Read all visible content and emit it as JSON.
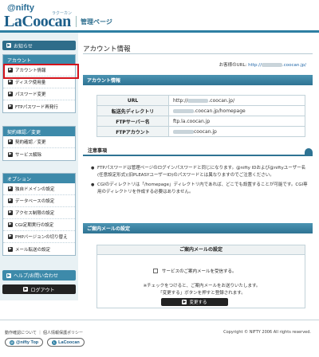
{
  "header": {
    "brand_nifty": "@nifty",
    "brand_lacoocan": "LaCoocan",
    "brand_ruby": "ラクーカン",
    "title": "管理ページ"
  },
  "sidebar": {
    "notice": "お知らせ",
    "account_section": {
      "heading": "アカウント",
      "items": [
        {
          "label": "アカウント情報"
        },
        {
          "label": "ディスク使用量"
        },
        {
          "label": "パスワード変更"
        },
        {
          "label": "FTPパスワード再発行"
        }
      ]
    },
    "contract_section": {
      "heading": "契約確認／変更",
      "items": [
        {
          "label": "契約確認／変更"
        },
        {
          "label": "サービス解除"
        }
      ]
    },
    "option_section": {
      "heading": "オプション",
      "items": [
        {
          "label": "独自ドメインの設定"
        },
        {
          "label": "データベースの設定"
        },
        {
          "label": "アクセス制限の設定"
        },
        {
          "label": "CGI定期実行の設定"
        },
        {
          "label": "PHPバージョンの切り替え"
        },
        {
          "label": "メール転送の設定"
        }
      ]
    },
    "help": "ヘルプ/お問い合わせ",
    "logout": "ログアウト"
  },
  "main": {
    "page_title": "アカウント情報",
    "user_url_label": "お客様のURL: ",
    "user_url_prefix": "http://",
    "user_url_suffix": ".coocan.jp/",
    "account_info": {
      "heading": "アカウント情報",
      "rows": [
        {
          "label": "URL",
          "value_prefix": "http://",
          "value_suffix": ".coocan.jp/"
        },
        {
          "label": "転送先ディレクトリ",
          "value_prefix": "",
          "value_suffix": ".coocan.jp/homepage"
        },
        {
          "label": "FTPサーバー名",
          "value_prefix": "ftp.la.coocan.jp",
          "value_suffix": ""
        },
        {
          "label": "FTPアカウント",
          "value_prefix": "",
          "value_suffix": "coocan.jp"
        }
      ]
    },
    "notes": {
      "heading": "注意事項",
      "items": [
        "FTPパスワードは管理ページのログインパスワードと同じになります。@nifty IDおよび@niftyユーザー名(任意設定形式)(旧PLEASYユーザーID)のパスワードとは異なりますのでご注意ください。",
        "CGIのディレクトリは「/homepage」ディレクトリ内であれば、どこでも設置することが可能です。CGI専用のディレクトリを作成する必要はありません。"
      ]
    },
    "mail": {
      "heading": "ご案内メールの設定",
      "box_title": "ご案内メールの設定",
      "checkbox_label": "サービスのご案内メールを受信する。",
      "note_line1": "※チェックをつけると、ご案内メールをお送りいたします。",
      "note_line2": "「変更する」ボタンを押すと登録されます。",
      "submit": "変更する"
    }
  },
  "footer": {
    "links": "動作確認について ｜ 個人情報保護ポリシー",
    "copyright": "Copyright © NIFTY 2006 All rights reserved.",
    "badge_nifty": "@nifty Top",
    "badge_lacoocan": "LaCoocan"
  },
  "colors": {
    "accent": "#2e7fa3",
    "highlight": "#d4141c"
  }
}
